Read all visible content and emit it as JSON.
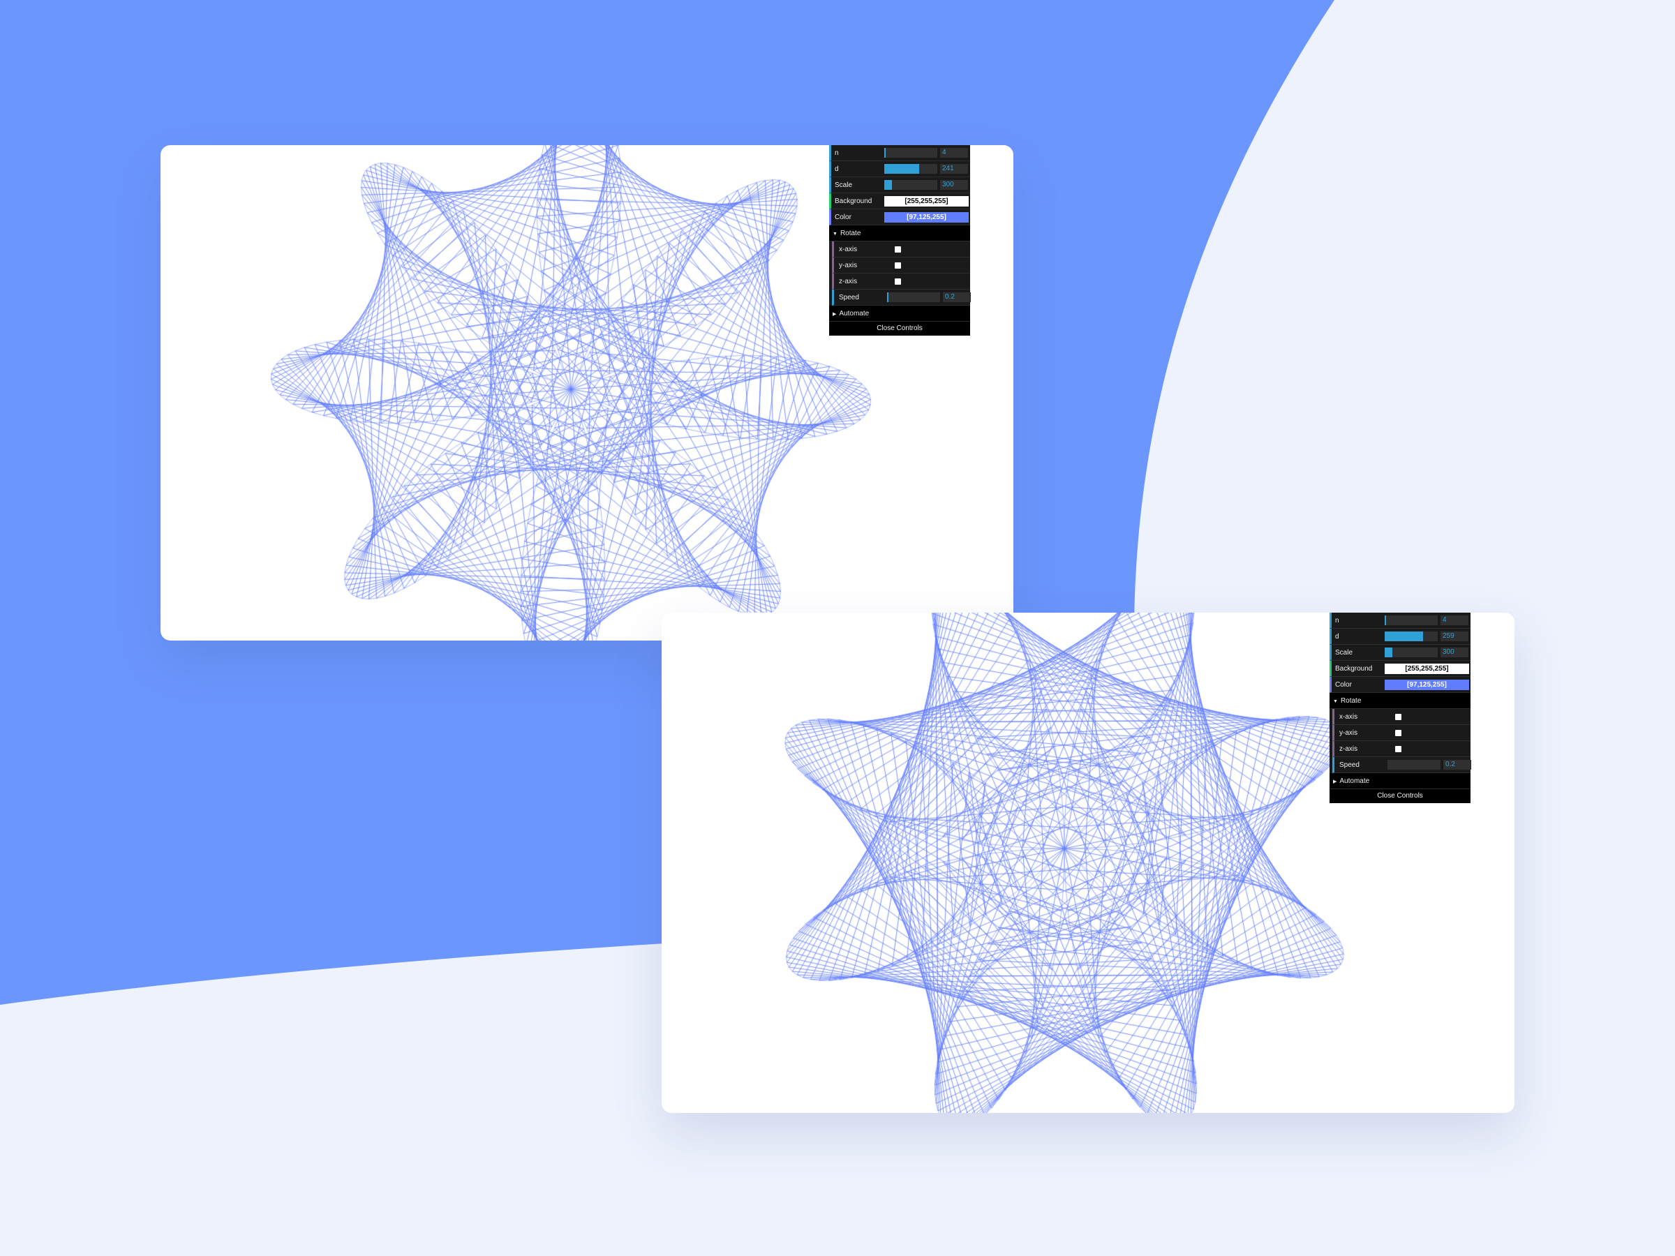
{
  "colors": {
    "bg_light": "#eef2fd",
    "bg_blue": "#6b96fd",
    "line": "#617dff",
    "accent": "#2fa1d6"
  },
  "panels": [
    {
      "n": {
        "label": "n",
        "value": "4",
        "fraction": 0.02
      },
      "d": {
        "label": "d",
        "value": "241",
        "fraction": 0.66
      },
      "scale": {
        "label": "Scale",
        "value": "300",
        "fraction": 0.14
      },
      "background": {
        "label": "Background",
        "value": "[255,255,255]",
        "hex": "#ffffff"
      },
      "color": {
        "label": "Color",
        "value": "[97,125,255]",
        "hex": "#617dff"
      },
      "rotate": {
        "title": "Rotate",
        "x_axis": {
          "label": "x-axis",
          "checked": false
        },
        "y_axis": {
          "label": "y-axis",
          "checked": false
        },
        "z_axis": {
          "label": "z-axis",
          "checked": false
        },
        "speed": {
          "label": "Speed",
          "value": "0.2",
          "fraction": 0.02
        }
      },
      "automate": {
        "title": "Automate"
      },
      "close": "Close Controls"
    },
    {
      "n": {
        "label": "n",
        "value": "4",
        "fraction": 0.02
      },
      "d": {
        "label": "d",
        "value": "259",
        "fraction": 0.72
      },
      "scale": {
        "label": "Scale",
        "value": "300",
        "fraction": 0.14
      },
      "background": {
        "label": "Background",
        "value": "[255,255,255]",
        "hex": "#ffffff"
      },
      "color": {
        "label": "Color",
        "value": "[97,125,255]",
        "hex": "#617dff"
      },
      "rotate": {
        "title": "Rotate",
        "x_axis": {
          "label": "x-axis",
          "checked": false
        },
        "y_axis": {
          "label": "y-axis",
          "checked": false
        },
        "z_axis": {
          "label": "z-axis",
          "checked": false
        },
        "speed": {
          "label": "Speed",
          "value": "0.2",
          "fraction": 0.0
        }
      },
      "automate": {
        "title": "Automate"
      },
      "close": "Close Controls"
    }
  ]
}
